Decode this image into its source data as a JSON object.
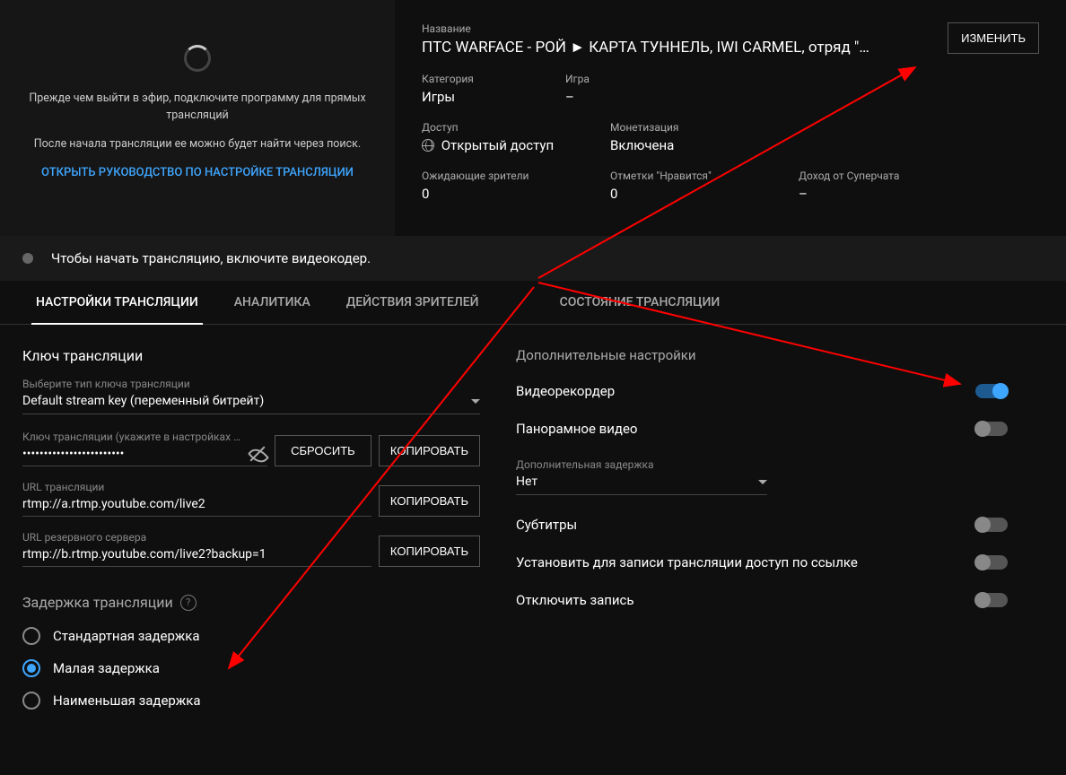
{
  "preview": {
    "text1": "Прежде чем выйти в эфир, подключите программу для прямых трансляций",
    "text2": "После начала трансляции ее можно будет найти через поиск.",
    "guide_link": "ОТКРЫТЬ РУКОВОДСТВО ПО НАСТРОЙКЕ ТРАНСЛЯЦИИ"
  },
  "info": {
    "title_label": "Название",
    "title_value": "ПТС WARFACE - РОЙ ► КАРТА ТУННЕЛЬ, IWI CARMEL, отряд \"…",
    "edit_button": "ИЗМЕНИТЬ",
    "category_label": "Категория",
    "category_value": "Игры",
    "game_label": "Игра",
    "game_value": "–",
    "access_label": "Доступ",
    "access_value": "Открытый доступ",
    "monetization_label": "Монетизация",
    "monetization_value": "Включена",
    "waiting_label": "Ожидающие зрители",
    "waiting_value": "0",
    "likes_label": "Отметки \"Нравится\"",
    "likes_value": "0",
    "superchat_label": "Доход от Суперчата",
    "superchat_value": "–"
  },
  "status_bar": {
    "text": "Чтобы начать трансляцию, включите видеокодер."
  },
  "tabs": {
    "settings": "НАСТРОЙКИ ТРАНСЛЯЦИИ",
    "analytics": "АНАЛИТИКА",
    "viewer_actions": "ДЕЙСТВИЯ ЗРИТЕЛЕЙ",
    "stream_state": "СОСТОЯНИЕ ТРАНСЛЯЦИИ"
  },
  "stream_key": {
    "section_title": "Ключ трансляции",
    "type_label": "Выберите тип ключа трансляции",
    "type_value": "Default stream key (переменный битрейт)",
    "key_label": "Ключ трансляции (укажите в настройках …",
    "key_value": "••••••••••••••••••••••••",
    "reset_btn": "СБРОСИТЬ",
    "copy_btn": "КОПИРОВАТЬ",
    "url_label": "URL трансляции",
    "url_value": "rtmp://a.rtmp.youtube.com/live2",
    "backup_label": "URL резервного сервера",
    "backup_value": "rtmp://b.rtmp.youtube.com/live2?backup=1"
  },
  "latency": {
    "title": "Задержка трансляции",
    "standard": "Стандартная задержка",
    "low": "Малая задержка",
    "ultra": "Наименьшая задержка"
  },
  "additional": {
    "title": "Дополнительные настройки",
    "dvr": "Видеорекордер",
    "pano": "Панорамное видео",
    "extra_delay_label": "Дополнительная задержка",
    "extra_delay_value": "Нет",
    "subtitles": "Субтитры",
    "unlisted": "Установить для записи трансляции доступ по ссылке",
    "disable_rec": "Отключить запись"
  }
}
